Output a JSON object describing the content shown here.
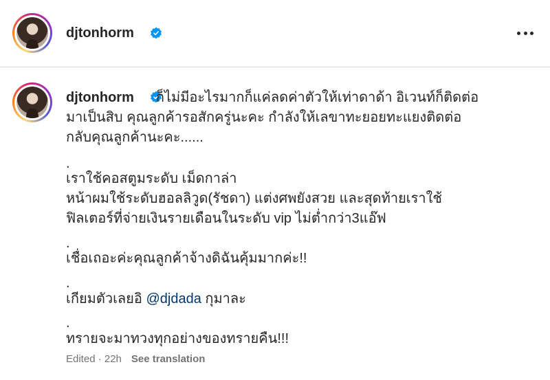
{
  "post": {
    "username": "djtonhorm",
    "more_icon": "more-horizontal-icon",
    "verified_icon": "verified-badge-icon"
  },
  "caption": {
    "username": "djtonhorm",
    "lines": [
      "ก็ไม่มีอะไรมากก็แค่ลดค่าตัวให้เท่าดาด้า อิเวนท์ก็ติดต่อ",
      "มาเป็นสิบ คุณลูกค้ารอสักครู่นะคะ กำลังให้เลขาทะยอยทะแยงติดต่อ",
      "กลับคุณลูกค้านะคะ......",
      ".",
      "เราใช้คอสตูมระดับ เม็ดกาล่า",
      "หน้าผมใช้ระดับฮอลลิวูด(รัชดา) แต่งศพยังสวย และสุดท้ายเราใช้",
      "ฟิลเตอร์ที่จ่ายเงินรายเดือนในระดับ vip ไม่ต่ำกว่า3แอ๊ฟ",
      ".",
      "เชื่อเถอะค่ะคุณลูกค้าจ้างดิฉันคุ้มมากค่ะ!!",
      ".",
      "__MENTION__",
      ".",
      "ทรายจะมาทวงทุกอย่างของทรายคืน!!!"
    ],
    "mention_prefix": "เกียมตัวเลยอิ ",
    "mention": "@djdada",
    "mention_suffix": " กุมาละ"
  },
  "meta": {
    "edited": "Edited · 22h",
    "see_translation": "See translation"
  },
  "colors": {
    "mention": "#00376b",
    "verified": "#0095f6",
    "meta": "#737373"
  }
}
